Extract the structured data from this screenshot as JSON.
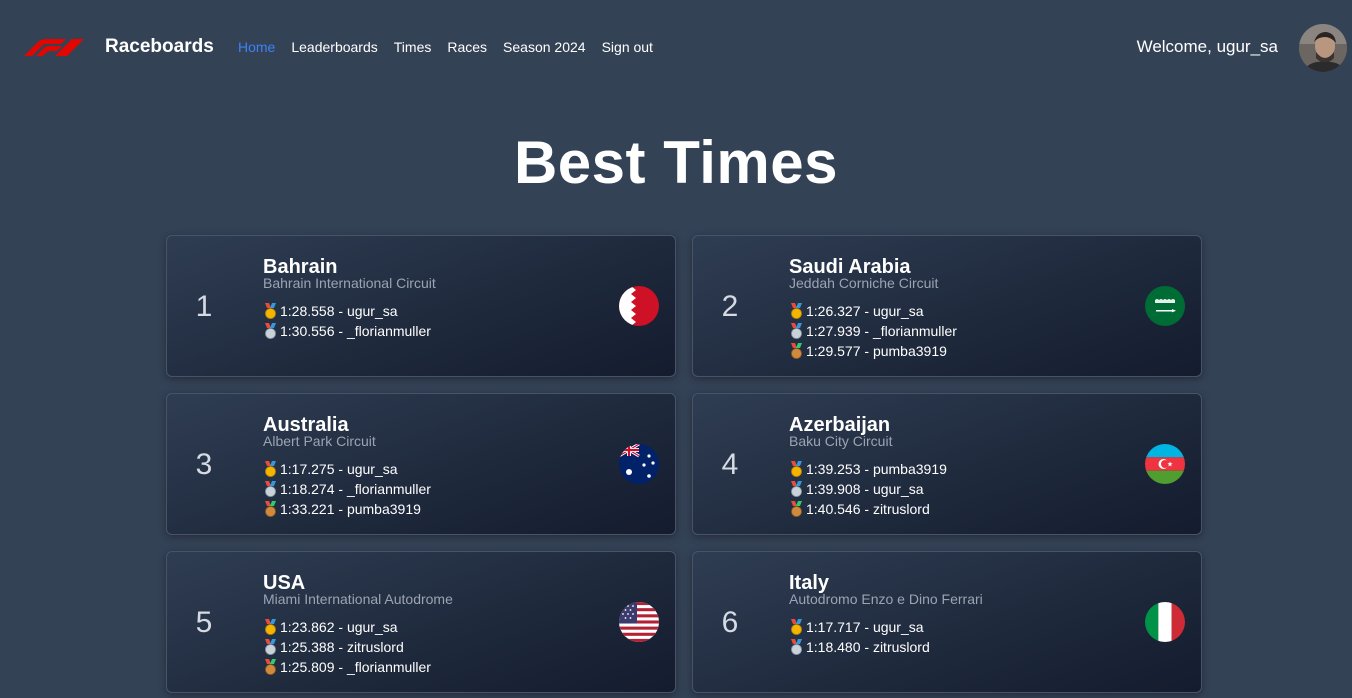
{
  "nav": {
    "brand": "Raceboards",
    "links": [
      "Home",
      "Leaderboards",
      "Times",
      "Races",
      "Season 2024",
      "Sign out"
    ],
    "welcome": "Welcome, ugur_sa",
    "accent_color": "#3b82f6"
  },
  "page": {
    "title": "Best Times"
  },
  "cards": [
    {
      "rank": "1",
      "country": "Bahrain",
      "circuit": "Bahrain International Circuit",
      "times": [
        {
          "medal": "gold",
          "text": "1:28.558 - ugur_sa"
        },
        {
          "medal": "silver",
          "text": "1:30.556 - _florianmuller"
        }
      ],
      "flag_icon": "bahrain-flag-icon"
    },
    {
      "rank": "2",
      "country": "Saudi Arabia",
      "circuit": "Jeddah Corniche Circuit",
      "times": [
        {
          "medal": "gold",
          "text": "1:26.327 - ugur_sa"
        },
        {
          "medal": "silver",
          "text": "1:27.939 - _florianmuller"
        },
        {
          "medal": "bronze",
          "text": "1:29.577 - pumba3919"
        }
      ],
      "flag_icon": "saudi-arabia-flag-icon"
    },
    {
      "rank": "3",
      "country": "Australia",
      "circuit": "Albert Park Circuit",
      "times": [
        {
          "medal": "gold",
          "text": "1:17.275 - ugur_sa"
        },
        {
          "medal": "silver",
          "text": "1:18.274 - _florianmuller"
        },
        {
          "medal": "bronze",
          "text": "1:33.221 - pumba3919"
        }
      ],
      "flag_icon": "australia-flag-icon"
    },
    {
      "rank": "4",
      "country": "Azerbaijan",
      "circuit": "Baku City Circuit",
      "times": [
        {
          "medal": "gold",
          "text": "1:39.253 - pumba3919"
        },
        {
          "medal": "silver",
          "text": "1:39.908 - ugur_sa"
        },
        {
          "medal": "bronze",
          "text": "1:40.546 - zitruslord"
        }
      ],
      "flag_icon": "azerbaijan-flag-icon"
    },
    {
      "rank": "5",
      "country": "USA",
      "circuit": "Miami International Autodrome",
      "times": [
        {
          "medal": "gold",
          "text": "1:23.862 - ugur_sa"
        },
        {
          "medal": "silver",
          "text": "1:25.388 - zitruslord"
        },
        {
          "medal": "bronze",
          "text": "1:25.809 - _florianmuller"
        }
      ],
      "flag_icon": "usa-flag-icon"
    },
    {
      "rank": "6",
      "country": "Italy",
      "circuit": "Autodromo Enzo e Dino Ferrari",
      "times": [
        {
          "medal": "gold",
          "text": "1:17.717 - ugur_sa"
        },
        {
          "medal": "silver",
          "text": "1:18.480 - zitruslord"
        }
      ],
      "flag_icon": "italy-flag-icon"
    }
  ]
}
